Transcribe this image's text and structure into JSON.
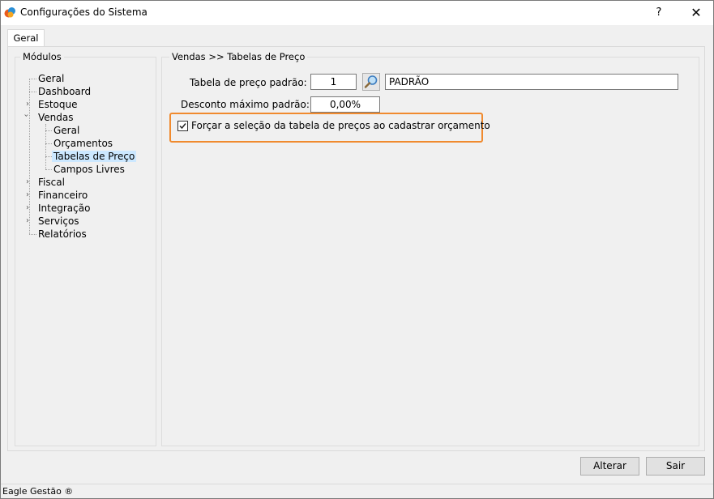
{
  "window": {
    "title": "Configurações do Sistema",
    "help_label": "?",
    "close_label": "✕"
  },
  "tabs": [
    {
      "label": "Geral",
      "selected": true
    }
  ],
  "modules": {
    "legend": "Módulos",
    "items": [
      {
        "label": "Geral",
        "level": 0,
        "expander": "none"
      },
      {
        "label": "Dashboard",
        "level": 0,
        "expander": "none"
      },
      {
        "label": "Estoque",
        "level": 0,
        "expander": "collapsed"
      },
      {
        "label": "Vendas",
        "level": 0,
        "expander": "expanded"
      },
      {
        "label": "Geral",
        "level": 1,
        "expander": "none"
      },
      {
        "label": "Orçamentos",
        "level": 1,
        "expander": "none"
      },
      {
        "label": "Tabelas de Preço",
        "level": 1,
        "expander": "none",
        "selected": true
      },
      {
        "label": "Campos Livres",
        "level": 1,
        "expander": "none"
      },
      {
        "label": "Fiscal",
        "level": 0,
        "expander": "collapsed"
      },
      {
        "label": "Financeiro",
        "level": 0,
        "expander": "collapsed"
      },
      {
        "label": "Integração",
        "level": 0,
        "expander": "collapsed"
      },
      {
        "label": "Serviços",
        "level": 0,
        "expander": "collapsed"
      },
      {
        "label": "Relatórios",
        "level": 0,
        "expander": "none"
      }
    ]
  },
  "settings": {
    "legend": "Vendas >> Tabelas de Preço",
    "price_table": {
      "label": "Tabela de preço padrão:",
      "code": "1",
      "name": "PADRÃO"
    },
    "discount": {
      "label": "Desconto máximo padrão:",
      "value": "0,00%"
    },
    "force_price_table": {
      "label": "Forçar a seleção da tabela de preços ao cadastrar orçamento",
      "checked": true
    }
  },
  "buttons": {
    "alter_label": "Alterar",
    "exit_label": "Sair"
  },
  "status": {
    "text": "Eagle Gestão ®"
  },
  "colors": {
    "highlight": "#f08a2e",
    "selection": "#cce8ff"
  }
}
